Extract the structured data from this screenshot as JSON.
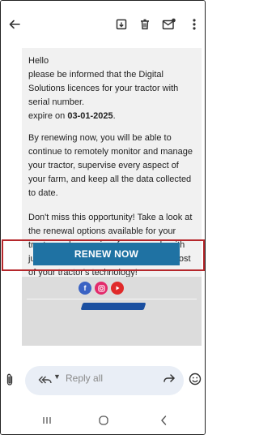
{
  "toolbar": {
    "back_icon": "arrow-left-icon",
    "archive_icon": "archive-icon",
    "delete_icon": "trash-icon",
    "mark_unread_icon": "mail-unread-icon",
    "more_icon": "more-vertical-icon"
  },
  "email": {
    "greeting": "Hello",
    "line1": "please be informed that the Digital Solutions licences for your tractor with serial number",
    "line1_suffix": ".",
    "expire_prefix": "expire on",
    "expire_date": "03-01-2025",
    "expire_suffix": ".",
    "paragraph2": "By renewing now, you will be able to continue to remotely monitor and manage your tractor, supervise every aspect of your farm, and keep all the data collected to date.",
    "paragraph3": "Don't miss this opportunity! Take a look at the renewal options available for your tractor and renew in a few seconds with just one click. Continue to make the most of your tractor's technology!",
    "cta_label": "RENEW NOW",
    "cta_color": "#1f72a3",
    "highlight_color": "#b5272b",
    "socials": [
      "facebook-icon",
      "instagram-icon",
      "youtube-icon"
    ]
  },
  "reply": {
    "placeholder": "Reply all",
    "attach_icon": "paperclip-icon",
    "reply_all_icon": "reply-all-icon",
    "forward_icon": "forward-icon",
    "emoji_icon": "emoji-icon"
  },
  "nav": {
    "recent_icon": "recent-apps-icon",
    "home_icon": "home-icon",
    "back_icon": "nav-back-icon"
  }
}
